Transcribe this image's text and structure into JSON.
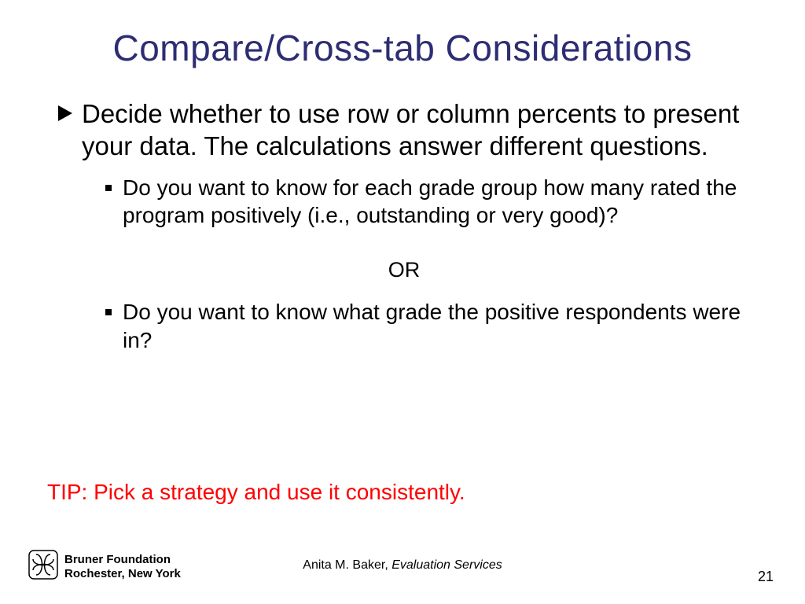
{
  "title": "Compare/Cross-tab Considerations",
  "bullet1": "Decide whether to use row or column percents to present your data.  The calculations answer different questions.",
  "sub1": "Do you want to know for each grade group how many rated the program positively (i.e., outstanding or very good)?",
  "or": "OR",
  "sub2": "Do you want to know what grade the positive respondents were in?",
  "tip": "TIP:  Pick a strategy and use it consistently.",
  "footer": {
    "org_line1": "Bruner Foundation",
    "org_line2": "Rochester, New York",
    "author_name": "Anita M. Baker, ",
    "author_svc": "Evaluation Services",
    "page": "21"
  }
}
